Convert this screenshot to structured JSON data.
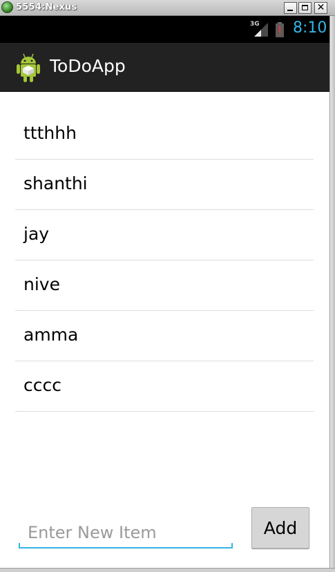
{
  "window": {
    "title": "5554:Nexus",
    "close_glyph": "✕"
  },
  "status_bar": {
    "network": "3G",
    "time": "8:10",
    "time_color": "#33b5e5"
  },
  "action_bar": {
    "icon": "android-icon",
    "title": "ToDoApp"
  },
  "todo_list": {
    "items": [
      "ttthhh",
      "shanthi",
      "jay",
      "nive",
      "amma",
      "cccc"
    ]
  },
  "new_item": {
    "placeholder": "Enter New Item",
    "value": "",
    "add_label": "Add",
    "accent_color": "#33b5e5"
  }
}
